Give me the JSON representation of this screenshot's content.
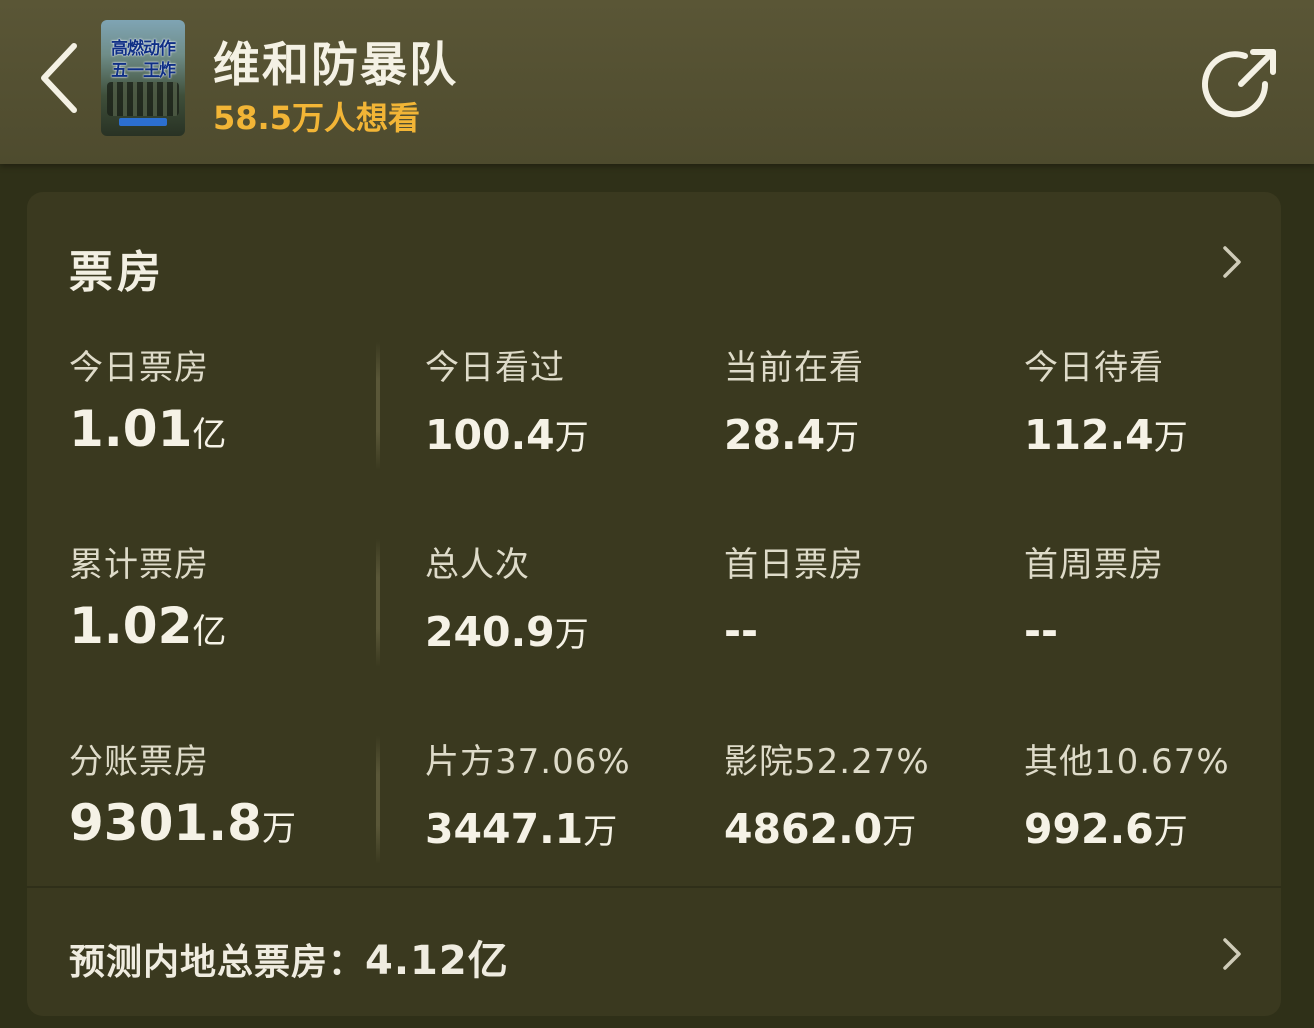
{
  "header": {
    "title": "维和防暴队",
    "want_count": "58.5万人想看",
    "poster_text_line1": "高燃动作",
    "poster_text_line2": "五一王炸"
  },
  "card": {
    "title": "票房",
    "rows": [
      [
        {
          "label": "今日票房",
          "value": "1.01",
          "unit": "亿"
        },
        {
          "label": "今日看过",
          "value": "100.4",
          "unit": "万"
        },
        {
          "label": "当前在看",
          "value": "28.4",
          "unit": "万"
        },
        {
          "label": "今日待看",
          "value": "112.4",
          "unit": "万"
        }
      ],
      [
        {
          "label": "累计票房",
          "value": "1.02",
          "unit": "亿"
        },
        {
          "label": "总人次",
          "value": "240.9",
          "unit": "万"
        },
        {
          "label": "首日票房",
          "value": "--",
          "unit": ""
        },
        {
          "label": "首周票房",
          "value": "--",
          "unit": ""
        }
      ],
      [
        {
          "label": "分账票房",
          "value": "9301.8",
          "unit": "万"
        },
        {
          "label": "片方37.06%",
          "value": "3447.1",
          "unit": "万"
        },
        {
          "label": "影院52.27%",
          "value": "4862.0",
          "unit": "万"
        },
        {
          "label": "其他10.67%",
          "value": "992.6",
          "unit": "万"
        }
      ]
    ],
    "forecast_label": "预测内地总票房：",
    "forecast_value": "4.12亿"
  },
  "icons": {
    "back": "chevron-left-icon",
    "share": "share-icon",
    "card_more": "chevron-right-icon",
    "forecast_more": "chevron-right-icon"
  },
  "colors": {
    "header_bg": "#55522f",
    "card_bg": "#3a391f",
    "accent_want": "#f2b536",
    "text_primary": "#f5f2e6"
  }
}
